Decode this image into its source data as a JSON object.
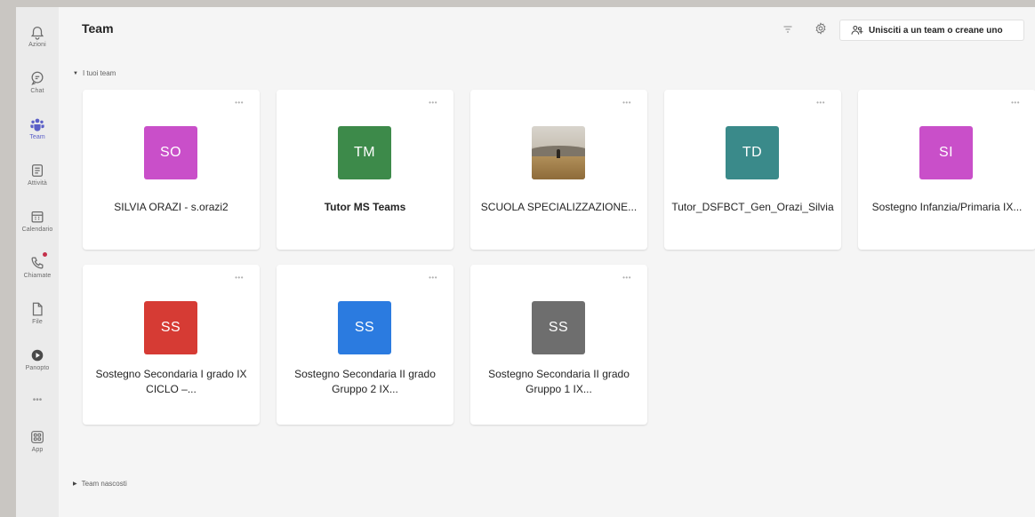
{
  "rail": [
    {
      "label": "Azioni",
      "icon": "bell-icon",
      "active": false
    },
    {
      "label": "Chat",
      "icon": "chat-icon",
      "active": false
    },
    {
      "label": "Team",
      "icon": "teams-icon",
      "active": true
    },
    {
      "label": "Attività",
      "icon": "activity-icon",
      "active": false
    },
    {
      "label": "Calendario",
      "icon": "calendar-icon",
      "active": false
    },
    {
      "label": "Chiamate",
      "icon": "phone-icon",
      "active": false
    },
    {
      "label": "File",
      "icon": "file-icon",
      "active": false
    },
    {
      "label": "Panopto",
      "icon": "panopto-icon",
      "active": false
    },
    {
      "label": "App",
      "icon": "apps-icon",
      "active": false
    }
  ],
  "header": {
    "title": "Team",
    "join_label": "Unisciti a un team o creane uno"
  },
  "sections": {
    "your_teams": "I tuoi team",
    "hidden_teams": "Team nascosti"
  },
  "teams": [
    {
      "initials": "SO",
      "name": "SILVIA ORAZI - s.orazi2",
      "color": "#c94fc9",
      "bold": false
    },
    {
      "initials": "TM",
      "name": "Tutor MS Teams",
      "color": "#3d8a4a",
      "bold": true
    },
    {
      "initials": "",
      "name": "SCUOLA SPECIALIZZAZIONE...",
      "color": "photo",
      "bold": false
    },
    {
      "initials": "TD",
      "name": "Tutor_DSFBCT_Gen_Orazi_Silvia",
      "color": "#3a8a8a",
      "bold": false
    },
    {
      "initials": "SI",
      "name": "Sostegno Infanzia/Primaria IX...",
      "color": "#c94fc9",
      "bold": false
    },
    {
      "initials": "SS",
      "name": "Sostegno Secondaria I grado IX CICLO –...",
      "color": "#d63b34",
      "bold": false
    },
    {
      "initials": "SS",
      "name": "Sostegno Secondaria II grado Gruppo 2 IX...",
      "color": "#2b7be0",
      "bold": false
    },
    {
      "initials": "SS",
      "name": "Sostegno Secondaria II grado Gruppo 1 IX...",
      "color": "#6e6e6e",
      "bold": false
    }
  ],
  "card_more": "•••"
}
